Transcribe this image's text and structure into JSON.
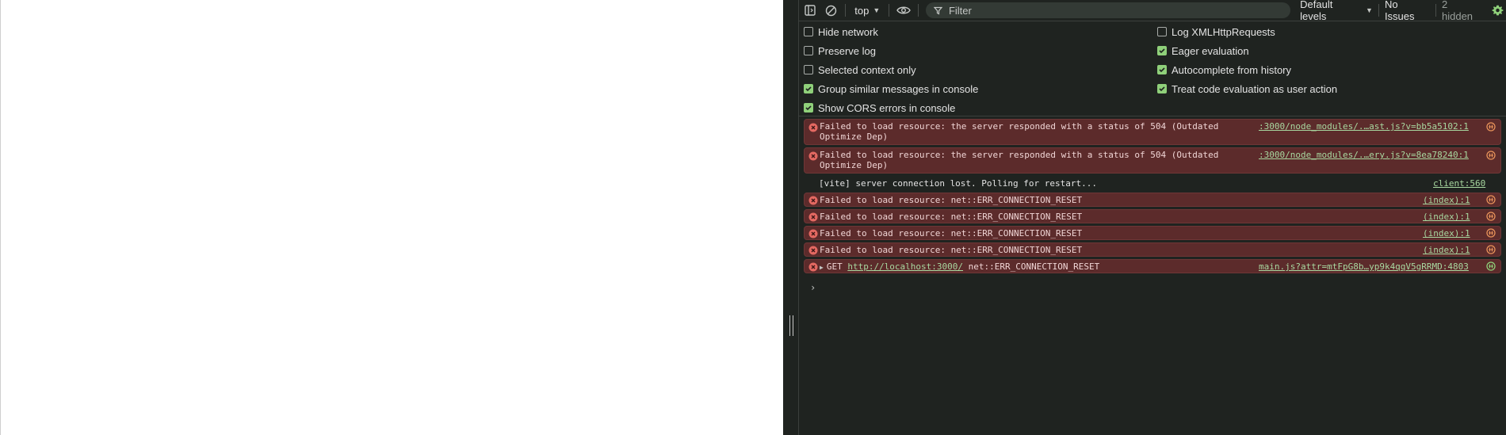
{
  "toolbar": {
    "context": "top",
    "filter_placeholder": "Filter",
    "levels": "Default levels",
    "issues": "No Issues",
    "hidden": "2 hidden"
  },
  "settings": {
    "left": [
      {
        "label": "Hide network",
        "checked": false
      },
      {
        "label": "Preserve log",
        "checked": false
      },
      {
        "label": "Selected context only",
        "checked": false
      },
      {
        "label": "Group similar messages in console",
        "checked": true
      },
      {
        "label": "Show CORS errors in console",
        "checked": true
      }
    ],
    "right": [
      {
        "label": "Log XMLHttpRequests",
        "checked": false
      },
      {
        "label": "Eager evaluation",
        "checked": true
      },
      {
        "label": "Autocomplete from history",
        "checked": true
      },
      {
        "label": "Treat code evaluation as user action",
        "checked": true
      }
    ]
  },
  "console": {
    "messages": [
      {
        "level": "error",
        "line1": "Failed to load resource: the server responded with a status of 504 (Outdated",
        "line2": "Optimize Dep)",
        "source": ":3000/node_modules/.…ast.js?v=bb5a5102:1"
      },
      {
        "level": "error",
        "line1": "Failed to load resource: the server responded with a status of 504 (Outdated",
        "line2": "Optimize Dep)",
        "source": ":3000/node_modules/.…ery.js?v=8ea78240:1"
      },
      {
        "level": "info",
        "line1": "[vite] server connection lost. Polling for restart...",
        "source": "client:560"
      },
      {
        "level": "error",
        "line1": "Failed to load resource: net::ERR_CONNECTION_RESET",
        "source": "(index):1"
      },
      {
        "level": "error",
        "line1": "Failed to load resource: net::ERR_CONNECTION_RESET",
        "source": "(index):1"
      },
      {
        "level": "error",
        "line1": "Failed to load resource: net::ERR_CONNECTION_RESET",
        "source": "(index):1"
      },
      {
        "level": "error",
        "line1": "Failed to load resource: net::ERR_CONNECTION_RESET",
        "source": "(index):1"
      }
    ],
    "get_message": {
      "method": "GET",
      "url": "http://localhost:3000/",
      "error": "net::ERR_CONNECTION_RESET",
      "source": "main.js?attr=mtFpG8b…yp9k4qqV5gRRMD:4803"
    },
    "prompt": "›"
  },
  "colors": {
    "panel_bg": "#1f2320",
    "error_bg": "#5c2b2b",
    "link": "#a8d8a0",
    "check": "#8fd07a"
  }
}
